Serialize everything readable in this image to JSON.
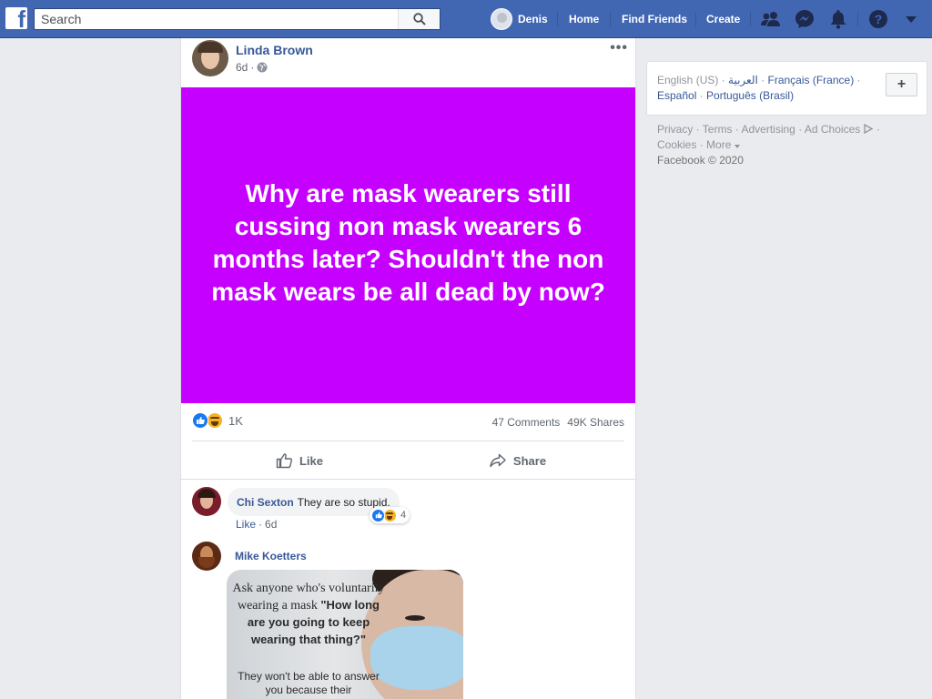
{
  "topbar": {
    "search_placeholder": "Search",
    "user_name": "Denis",
    "nav": [
      "Home",
      "Find Friends",
      "Create"
    ]
  },
  "post": {
    "author": "Linda Brown",
    "time": "6d",
    "privacy_icon": "globe-icon",
    "text": "Why are mask wearers still cussing non mask wearers 6 months later? Shouldn't the non mask wears be all dead by now?",
    "background_color": "#c600ff",
    "reaction_count": "1K",
    "comments": "47 Comments",
    "shares": "49K Shares",
    "like_label": "Like",
    "share_label": "Share"
  },
  "comments": [
    {
      "name": "Chi Sexton",
      "text": "They are so stupid.",
      "reaction_count": "4",
      "like_label": "Like",
      "time": "6d"
    },
    {
      "name": "Mike Koetters",
      "meme_line1": "Ask anyone who's voluntarily wearing a mask",
      "meme_bold": "\"How long are you going to keep wearing that thing?\"",
      "meme_line2": "They won't be able to answer you because their"
    }
  ],
  "sidebar": {
    "lang_current": "English (US)",
    "lang_links": [
      "العربية",
      "Français (France)",
      "Español",
      "Português (Brasil)"
    ],
    "lang_add": "+",
    "footer_links": [
      "Privacy",
      "Terms",
      "Advertising",
      "Ad Choices",
      "Cookies",
      "More"
    ],
    "copyright": "Facebook © 2020"
  }
}
